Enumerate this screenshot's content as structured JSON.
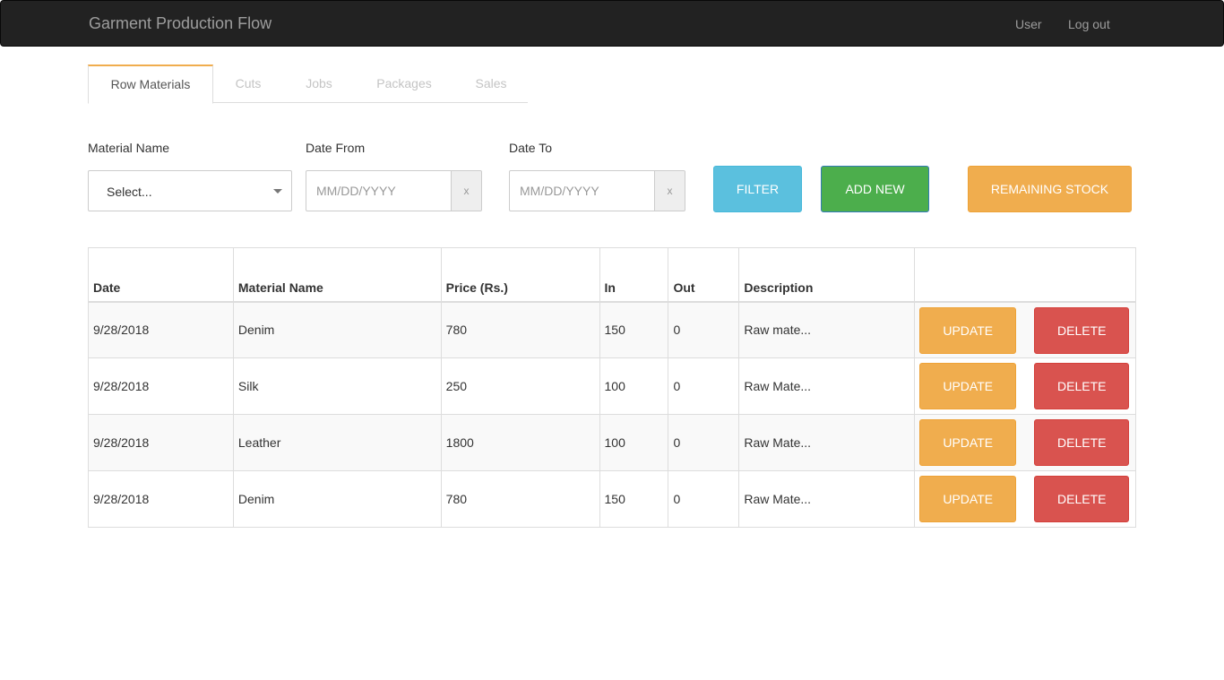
{
  "navbar": {
    "brand": "Garment Production Flow",
    "user_link": "User",
    "logout_link": "Log out"
  },
  "tabs": [
    {
      "label": "Row Materials",
      "active": true
    },
    {
      "label": "Cuts",
      "active": false
    },
    {
      "label": "Jobs",
      "active": false
    },
    {
      "label": "Packages",
      "active": false
    },
    {
      "label": "Sales",
      "active": false
    }
  ],
  "filters": {
    "material_label": "Material Name",
    "material_value": "Select...",
    "date_from_label": "Date From",
    "date_from_placeholder": "MM/DD/YYYY",
    "date_to_label": "Date To",
    "date_to_placeholder": "MM/DD/YYYY",
    "clear_glyph": "x"
  },
  "buttons": {
    "filter": "FILTER",
    "add_new": "ADD NEW",
    "remaining_stock": "REMAINING STOCK"
  },
  "table": {
    "columns": [
      "Date",
      "Material Name",
      "Price (Rs.)",
      "In",
      "Out",
      "Description",
      ""
    ],
    "rows": [
      {
        "date": "9/28/2018",
        "material": "Denim",
        "price": "780",
        "in": "150",
        "out": "0",
        "description": "Raw mate..."
      },
      {
        "date": "9/28/2018",
        "material": "Silk",
        "price": "250",
        "in": "100",
        "out": "0",
        "description": "Raw Mate..."
      },
      {
        "date": "9/28/2018",
        "material": "Leather",
        "price": "1800",
        "in": "100",
        "out": "0",
        "description": "Raw Mate..."
      },
      {
        "date": "9/28/2018",
        "material": "Denim",
        "price": "780",
        "in": "150",
        "out": "0",
        "description": "Raw Mate..."
      }
    ],
    "update_label": "UPDATE",
    "delete_label": "DELETE"
  },
  "colors": {
    "navbar_bg": "#222222",
    "tab_accent": "#f0ad4e",
    "filter_btn": "#5bc0de",
    "add_btn": "#4cae4c",
    "warning_btn": "#f0ad4e",
    "danger_btn": "#d9534f"
  }
}
